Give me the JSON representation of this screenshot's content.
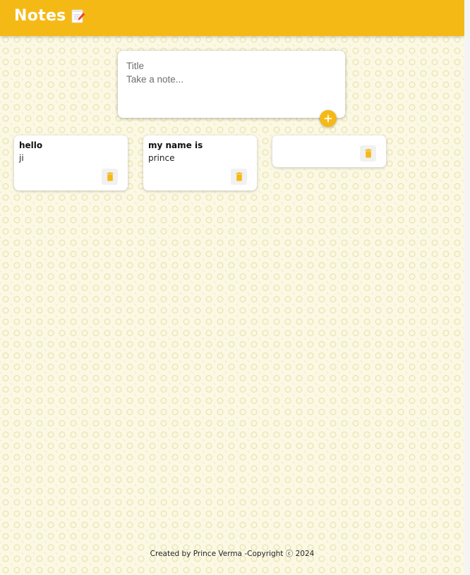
{
  "header": {
    "title": "Notes",
    "icon": "memo-icon"
  },
  "create_area": {
    "title_placeholder": "Title",
    "content_placeholder": "Take a note...",
    "add_icon": "plus-icon"
  },
  "notes": [
    {
      "title": "hello",
      "content": "ji",
      "delete_icon": "trash-icon"
    },
    {
      "title": "my name is",
      "content": "prince",
      "delete_icon": "trash-icon"
    },
    {
      "title": "",
      "content": "",
      "delete_icon": "trash-icon"
    }
  ],
  "footer": {
    "text": "Created by Prince Verma -Copyright ⓒ 2024"
  },
  "colors": {
    "accent": "#f5b916",
    "background": "#fbf8e4"
  }
}
